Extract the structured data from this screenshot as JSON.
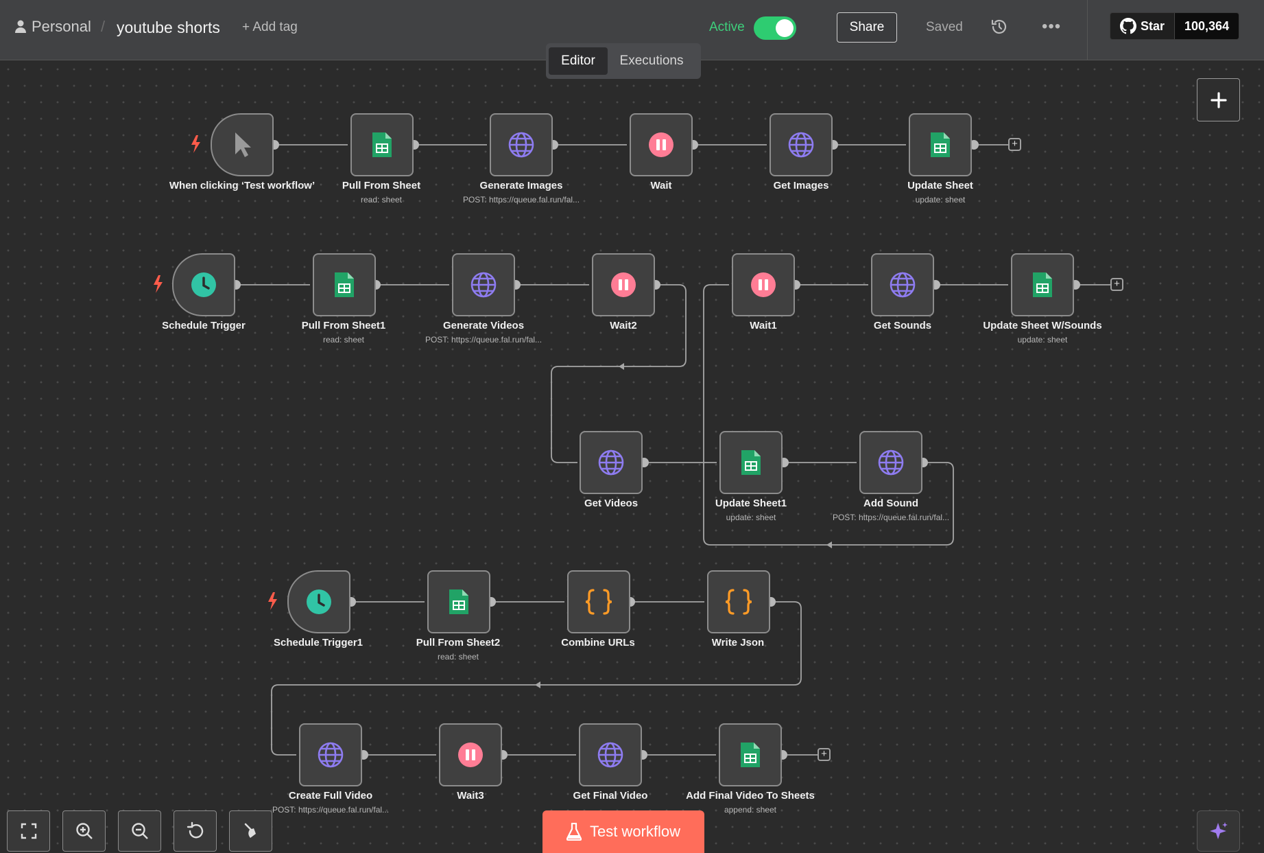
{
  "header": {
    "breadcrumb_personal": "Personal",
    "breadcrumb_sep": "/",
    "workflow_name": "youtube shorts",
    "add_tag": "+ Add tag",
    "active_label": "Active",
    "active_on": true,
    "share_label": "Share",
    "saved_label": "Saved",
    "more_label": "•••",
    "github_star": "Star",
    "github_count": "100,364"
  },
  "tabs": {
    "editor": "Editor",
    "executions": "Executions"
  },
  "nodes": {
    "manual_trigger": {
      "label": "When clicking ‘Test workflow’",
      "icon": "cursor-icon"
    },
    "pull_from_sheet": {
      "label": "Pull From Sheet",
      "sub": "read: sheet",
      "icon": "sheets-icon"
    },
    "generate_images": {
      "label": "Generate Images",
      "sub": "POST: https://queue.fal.run/fal...",
      "icon": "globe-icon"
    },
    "wait": {
      "label": "Wait",
      "icon": "pause-icon"
    },
    "get_images": {
      "label": "Get Images",
      "icon": "globe-icon"
    },
    "update_sheet": {
      "label": "Update Sheet",
      "sub": "update: sheet",
      "icon": "sheets-icon"
    },
    "schedule_trigger": {
      "label": "Schedule Trigger",
      "icon": "clock-icon"
    },
    "pull_from_sheet1": {
      "label": "Pull From Sheet1",
      "sub": "read: sheet",
      "icon": "sheets-icon"
    },
    "generate_videos": {
      "label": "Generate Videos",
      "sub": "POST: https://queue.fal.run/fal...",
      "icon": "globe-icon"
    },
    "wait2": {
      "label": "Wait2",
      "icon": "pause-icon"
    },
    "wait1": {
      "label": "Wait1",
      "icon": "pause-icon"
    },
    "get_sounds": {
      "label": "Get Sounds",
      "icon": "globe-icon"
    },
    "update_sheet_sounds": {
      "label": "Update Sheet W/Sounds",
      "sub": "update: sheet",
      "icon": "sheets-icon"
    },
    "get_videos": {
      "label": "Get Videos",
      "icon": "globe-icon"
    },
    "update_sheet1": {
      "label": "Update Sheet1",
      "sub": "update: sheet",
      "icon": "sheets-icon"
    },
    "add_sound": {
      "label": "Add Sound",
      "sub": "POST: https://queue.fal.run/fal...",
      "icon": "globe-icon"
    },
    "schedule_trigger1": {
      "label": "Schedule Trigger1",
      "icon": "clock-icon"
    },
    "pull_from_sheet2": {
      "label": "Pull From Sheet2",
      "sub": "read: sheet",
      "icon": "sheets-icon"
    },
    "combine_urls": {
      "label": "Combine URLs",
      "icon": "braces-icon"
    },
    "write_json": {
      "label": "Write Json",
      "icon": "braces-icon"
    },
    "create_full_video": {
      "label": "Create Full Video",
      "sub": "POST: https://queue.fal.run/fal...",
      "icon": "globe-icon"
    },
    "wait3": {
      "label": "Wait3",
      "icon": "pause-icon"
    },
    "get_final_video": {
      "label": "Get Final Video",
      "icon": "globe-icon"
    },
    "add_final_video": {
      "label": "Add Final Video To Sheets",
      "sub": "append: sheet",
      "icon": "sheets-icon"
    }
  },
  "footer": {
    "test_workflow": "Test workflow"
  },
  "colors": {
    "accent": "#ff6d5a",
    "active_green": "#2ecc71",
    "sheets_green": "#21a366",
    "http_purple": "#8e7cf0",
    "wait_pink": "#ff7d95",
    "schedule_teal": "#31c4a5",
    "code_orange": "#ff9b26"
  }
}
